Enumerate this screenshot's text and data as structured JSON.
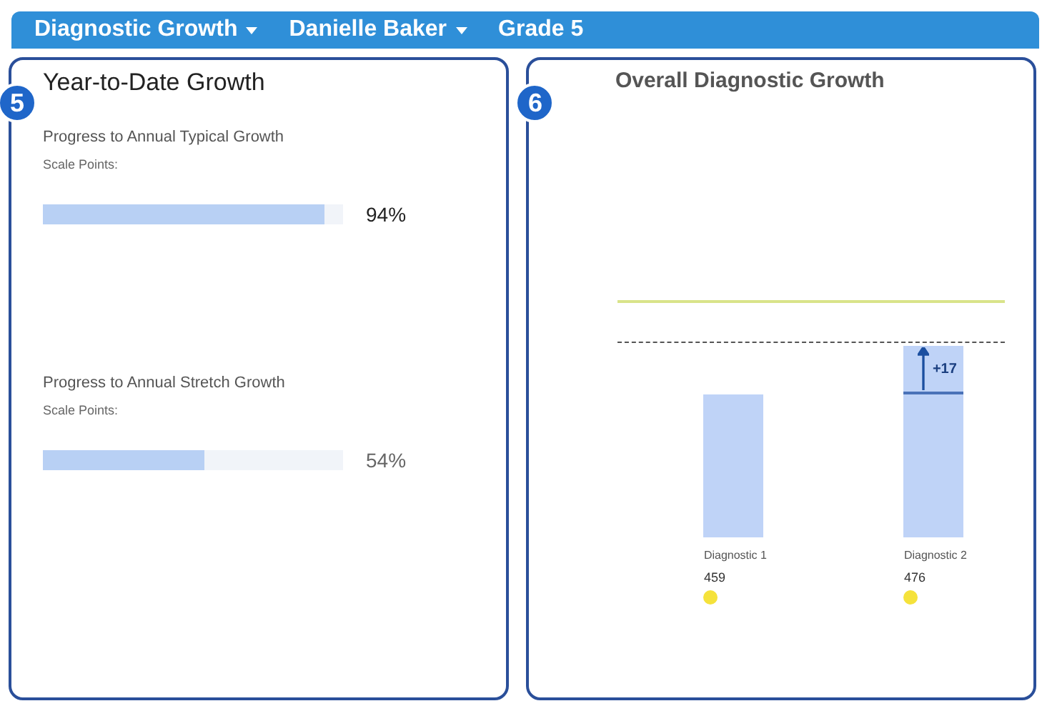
{
  "header": {
    "items": [
      {
        "label": "Diagnostic Growth",
        "dropdown": true
      },
      {
        "label": "Danielle Baker",
        "dropdown": true
      },
      {
        "label": "Grade 5",
        "dropdown": false
      }
    ]
  },
  "ytd_card": {
    "badge": "5",
    "title": "Year-to-Date Growth",
    "progress": [
      {
        "title": "Progress to Annual Typical Growth",
        "subtitle": "Scale Points:",
        "level": 0.94,
        "reading": "94%"
      },
      {
        "title": "Progress to Annual Stretch Growth",
        "subtitle": "Scale Points:",
        "level": 0.54,
        "reading": "54%"
      }
    ]
  },
  "growth_card": {
    "badge": "6",
    "title": "Overall Diagnostic Growth",
    "gain": "+17",
    "bars": [
      {
        "label": "Diagnostic 1",
        "score": "459"
      },
      {
        "label": "Diagnostic 2",
        "score": "476"
      }
    ]
  }
}
